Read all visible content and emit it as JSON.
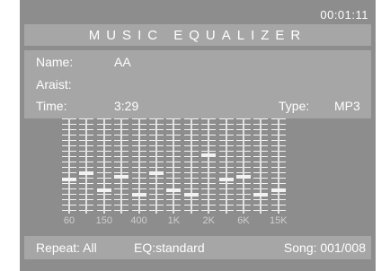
{
  "header": {
    "elapsed_time": "00:01:11",
    "title": "MUSIC EQUALIZER"
  },
  "info": {
    "name_label": "Name:",
    "name_value": "AA",
    "artist_label": "Araist:",
    "artist_value": "",
    "time_label": "Time:",
    "time_value": "3:29",
    "type_label": "Type:",
    "type_value": "MP3"
  },
  "equalizer": {
    "bands": [
      {
        "level": 0.33,
        "freq_label": "60"
      },
      {
        "level": 0.4,
        "freq_label": ""
      },
      {
        "level": 0.2,
        "freq_label": "150"
      },
      {
        "level": 0.36,
        "freq_label": ""
      },
      {
        "level": 0.15,
        "freq_label": "400"
      },
      {
        "level": 0.4,
        "freq_label": ""
      },
      {
        "level": 0.2,
        "freq_label": "1K"
      },
      {
        "level": 0.15,
        "freq_label": ""
      },
      {
        "level": 0.6,
        "freq_label": "2K"
      },
      {
        "level": 0.33,
        "freq_label": ""
      },
      {
        "level": 0.36,
        "freq_label": "6K"
      },
      {
        "level": 0.15,
        "freq_label": ""
      },
      {
        "level": 0.2,
        "freq_label": "15K"
      }
    ]
  },
  "status": {
    "repeat": "Repeat: All",
    "eq_mode": "EQ:standard",
    "song": "Song: 001/008"
  },
  "colors": {
    "panel": "#a6a6a6",
    "background": "#8d8d8d",
    "text": "#ffffff"
  }
}
